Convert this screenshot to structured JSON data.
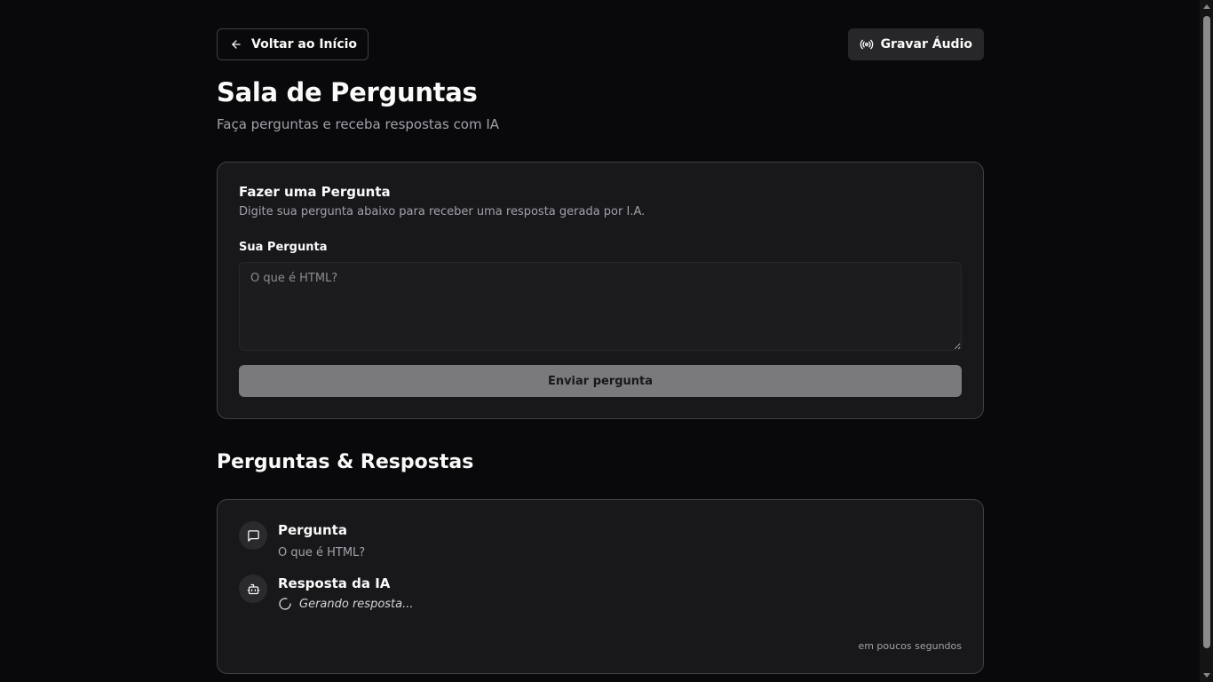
{
  "header": {
    "back_label": "Voltar ao Início",
    "back_icon": "arrow-left-icon",
    "record_label": "Gravar Áudio",
    "record_icon": "radio-broadcast-icon"
  },
  "page": {
    "title": "Sala de Perguntas",
    "subtitle": "Faça perguntas e receba respostas com IA"
  },
  "ask_form": {
    "title": "Fazer uma Pergunta",
    "description": "Digite sua pergunta abaixo para receber uma resposta gerada por I.A.",
    "field_label": "Sua Pergunta",
    "placeholder": "O que é HTML?",
    "value": "",
    "submit_label": "Enviar pergunta"
  },
  "qa_section": {
    "title": "Perguntas & Respostas",
    "items": [
      {
        "question_heading": "Pergunta",
        "question_icon": "message-square-icon",
        "question_text": "O que é HTML?",
        "answer_heading": "Resposta da IA",
        "answer_icon": "bot-icon",
        "answer_status": "Gerando resposta...",
        "timestamp": "em poucos segundos"
      }
    ]
  },
  "colors": {
    "background": "#09090b",
    "card": "#18181b",
    "border": "#3f3f46",
    "muted_text": "#a1a1aa",
    "submit_button": "#7a7a7c"
  }
}
